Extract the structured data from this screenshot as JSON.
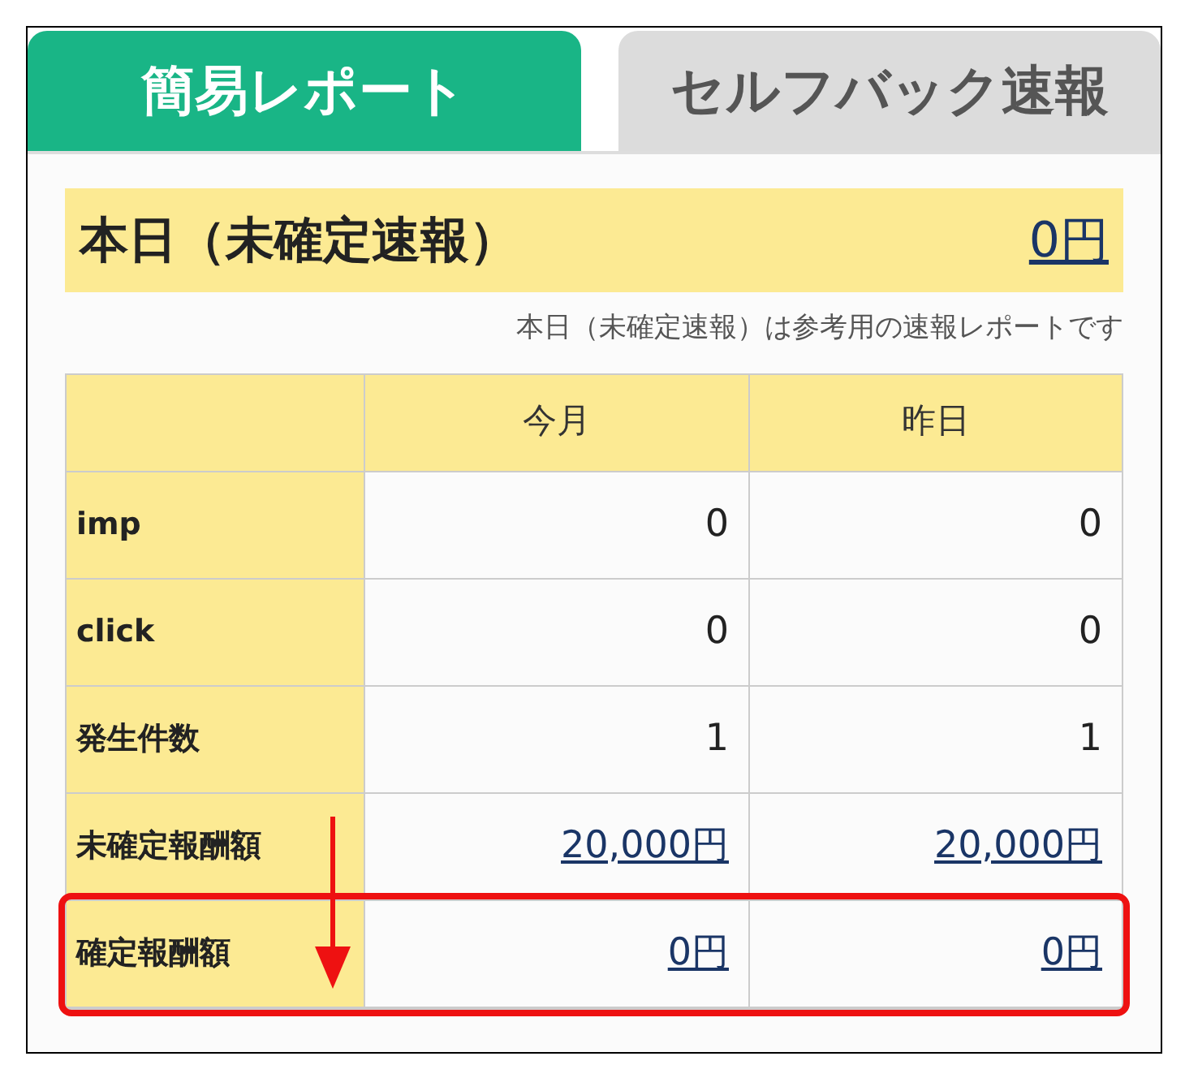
{
  "tabs": [
    {
      "label": "簡易レポート",
      "selected": true
    },
    {
      "label": "セルフバック速報",
      "selected": false
    }
  ],
  "today": {
    "title": "本日（未確定速報）",
    "amount": "0円",
    "note": "本日（未確定速報）は参考用の速報レポートです"
  },
  "table": {
    "columns": [
      "今月",
      "昨日"
    ],
    "rows": [
      {
        "label": "imp",
        "link": false,
        "highlighted": false,
        "values": [
          "0",
          "0"
        ]
      },
      {
        "label": "click",
        "link": false,
        "highlighted": false,
        "values": [
          "0",
          "0"
        ]
      },
      {
        "label": "発生件数",
        "link": false,
        "highlighted": false,
        "values": [
          "1",
          "1"
        ]
      },
      {
        "label": "未確定報酬額",
        "link": true,
        "highlighted": false,
        "values": [
          "20,000円",
          "20,000円"
        ]
      },
      {
        "label": "確定報酬額",
        "link": true,
        "highlighted": true,
        "values": [
          "0円",
          "0円"
        ]
      }
    ]
  }
}
